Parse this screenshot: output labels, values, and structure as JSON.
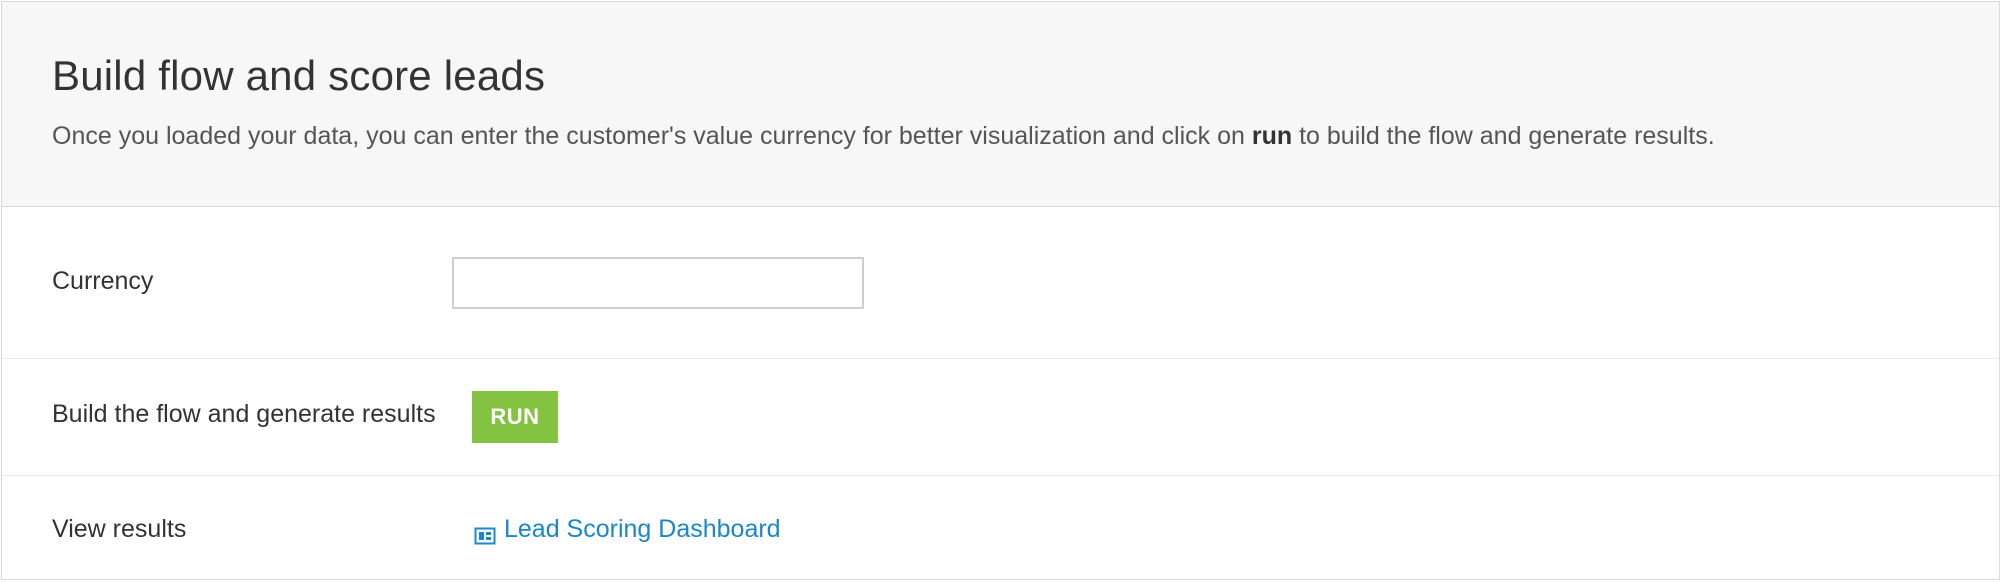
{
  "header": {
    "title": "Build flow and score leads",
    "description_before": "Once you loaded your data, you can enter the customer's value currency for better visualization and click on ",
    "description_bold": "run",
    "description_after": " to build the flow and generate results."
  },
  "rows": {
    "currency": {
      "label": "Currency",
      "value": "",
      "placeholder": ""
    },
    "run": {
      "label": "Build the flow and generate results",
      "button_label": "RUN"
    },
    "results": {
      "label": "View results",
      "link_label": "Lead Scoring Dashboard",
      "link_icon": "dashboard-icon"
    }
  },
  "colors": {
    "run_button": "#84c341",
    "link": "#1a87c9",
    "header_background": "#f7f7f7"
  }
}
